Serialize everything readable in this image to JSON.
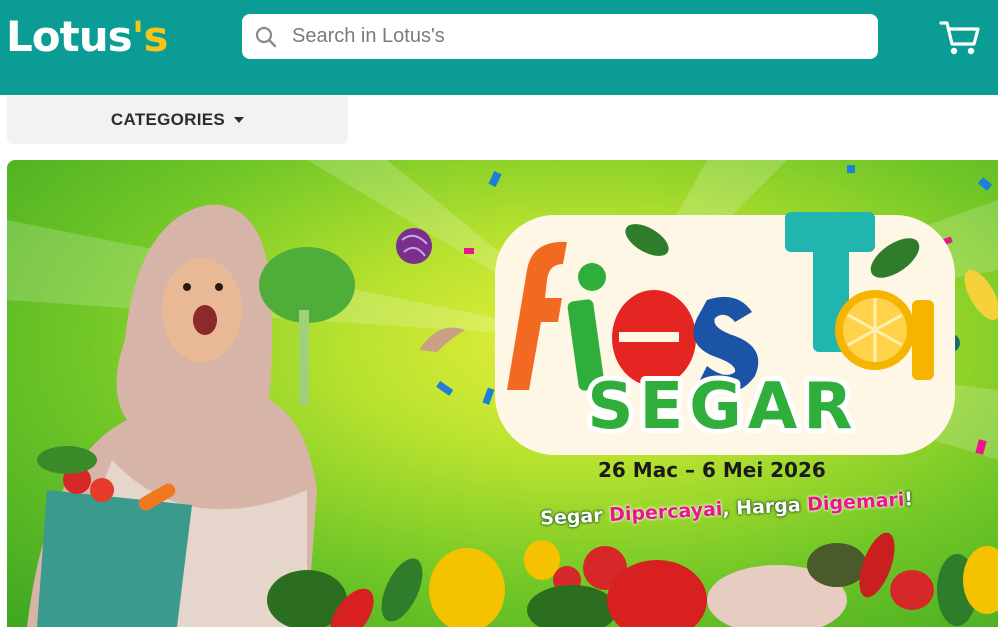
{
  "header": {
    "logo": {
      "main": "Lotus",
      "apostrophe": "'",
      "suffix": "s"
    },
    "search": {
      "placeholder": "Search in Lotus's",
      "value": ""
    },
    "cart_icon": "cart-icon"
  },
  "nav": {
    "categories_label": "CATEGORIES"
  },
  "banner": {
    "headline_top": "fiesTa",
    "headline_bottom": "SEGAR",
    "date": "26 Mac – 6 Mei 2026",
    "tagline": {
      "w1": "Segar ",
      "m1": "Dipercayai",
      "w2": ", Harga ",
      "m2": "Digemari",
      "w3": "!"
    }
  },
  "colors": {
    "header_bg": "#0b9c95",
    "logo_accent": "#f5c518",
    "banner_green": "#6fc627",
    "tagline_magenta": "#e8168a"
  }
}
